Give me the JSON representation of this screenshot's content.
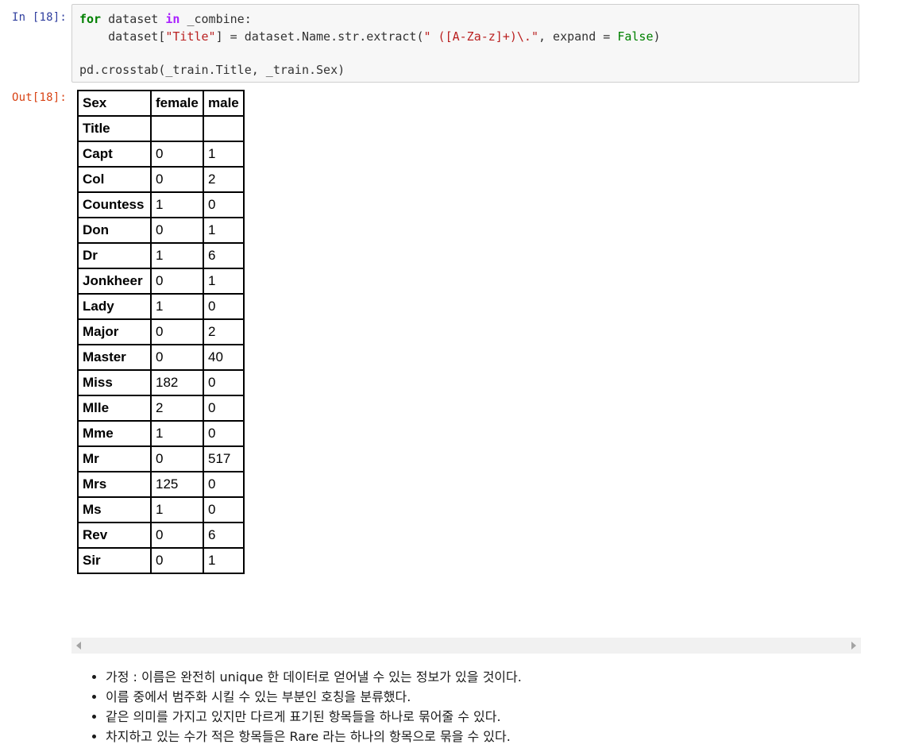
{
  "input_cell": {
    "prompt": "In [18]:",
    "code": {
      "l1_kw": "for",
      "l1_a": " dataset ",
      "l1_in": "in",
      "l1_b": " _combine:",
      "l2_a": "    dataset[",
      "l2_str1": "\"Title\"",
      "l2_b": "] = dataset.Name.str.extract(",
      "l2_str2": "\" ([A-Za-z]+)\\.\"",
      "l2_c": ", expand = ",
      "l2_const": "False",
      "l2_d": ")",
      "l4": "pd.crosstab(_train.Title, _train.Sex)"
    }
  },
  "output_cell": {
    "prompt": "Out[18]:",
    "table": {
      "header": [
        "Sex",
        "female",
        "male"
      ],
      "index_name": "Title",
      "rows": [
        [
          "Capt",
          "0",
          "1"
        ],
        [
          "Col",
          "0",
          "2"
        ],
        [
          "Countess",
          "1",
          "0"
        ],
        [
          "Don",
          "0",
          "1"
        ],
        [
          "Dr",
          "1",
          "6"
        ],
        [
          "Jonkheer",
          "0",
          "1"
        ],
        [
          "Lady",
          "1",
          "0"
        ],
        [
          "Major",
          "0",
          "2"
        ],
        [
          "Master",
          "0",
          "40"
        ],
        [
          "Miss",
          "182",
          "0"
        ],
        [
          "Mlle",
          "2",
          "0"
        ],
        [
          "Mme",
          "1",
          "0"
        ],
        [
          "Mr",
          "0",
          "517"
        ],
        [
          "Mrs",
          "125",
          "0"
        ],
        [
          "Ms",
          "1",
          "0"
        ],
        [
          "Rev",
          "0",
          "6"
        ],
        [
          "Sir",
          "0",
          "1"
        ]
      ]
    }
  },
  "markdown": {
    "bullets": [
      "가정 : 이름은 완전히 unique 한 데이터로 얻어낼 수 있는 정보가 있을 것이다.",
      "이름 중에서 범주화 시킬 수 있는 부분인 호칭을 분류했다.",
      "같은 의미를 가지고 있지만 다르게 표기된 항목들을 하나로 묶어줄 수 있다.",
      "차지하고 있는 수가 적은 항목들은 Rare 라는 하나의 항목으로 묶을 수 있다."
    ]
  }
}
